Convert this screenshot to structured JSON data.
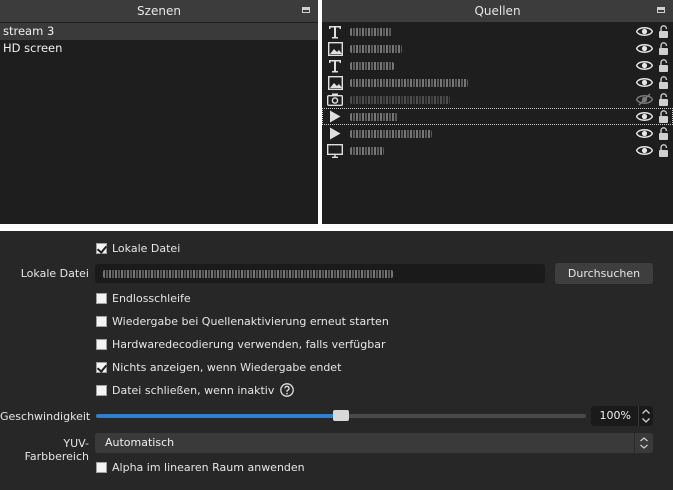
{
  "scenes_panel": {
    "title": "Szenen",
    "items": [
      {
        "label": "stream 3",
        "selected": true
      },
      {
        "label": "HD screen",
        "selected": false
      }
    ]
  },
  "sources_panel": {
    "title": "Quellen",
    "items": [
      {
        "icon": "text-icon",
        "visible": true,
        "selected": false
      },
      {
        "icon": "image-icon",
        "visible": true,
        "selected": false
      },
      {
        "icon": "text-icon",
        "visible": true,
        "selected": false
      },
      {
        "icon": "image-icon",
        "visible": true,
        "selected": false
      },
      {
        "icon": "camera-icon",
        "visible": false,
        "selected": false
      },
      {
        "icon": "media-play-icon",
        "visible": true,
        "selected": true
      },
      {
        "icon": "media-play-icon",
        "visible": true,
        "selected": false
      },
      {
        "icon": "display-icon",
        "visible": true,
        "selected": false
      }
    ]
  },
  "properties": {
    "local_file_checkbox": {
      "label": "Lokale Datei",
      "checked": true
    },
    "local_file": {
      "label": "Lokale Datei",
      "browse_label": "Durchsuchen"
    },
    "loop": {
      "label": "Endlosschleife",
      "checked": false
    },
    "restart": {
      "label": "Wiedergabe bei Quellenaktivierung erneut starten",
      "checked": false
    },
    "hw_decode": {
      "label": "Hardwaredecodierung verwenden, falls verfügbar",
      "checked": false
    },
    "hide_on_end": {
      "label": "Nichts anzeigen, wenn Wiedergabe endet",
      "checked": true
    },
    "close_inactive": {
      "label": "Datei schließen, wenn inaktiv",
      "checked": false
    },
    "speed": {
      "label": "Geschwindigkeit",
      "value_text": "100%",
      "slider_fraction": 0.5
    },
    "yuv": {
      "label": "YUV-Farbbereich",
      "value": "Automatisch"
    },
    "linear_alpha": {
      "label": "Alpha im linearen Raum anwenden",
      "checked": false
    }
  },
  "colors": {
    "panel_bg": "#1e1e1e",
    "header_bg": "#3c3c3c",
    "props_bg": "#272727",
    "accent": "#2f7fcf"
  }
}
